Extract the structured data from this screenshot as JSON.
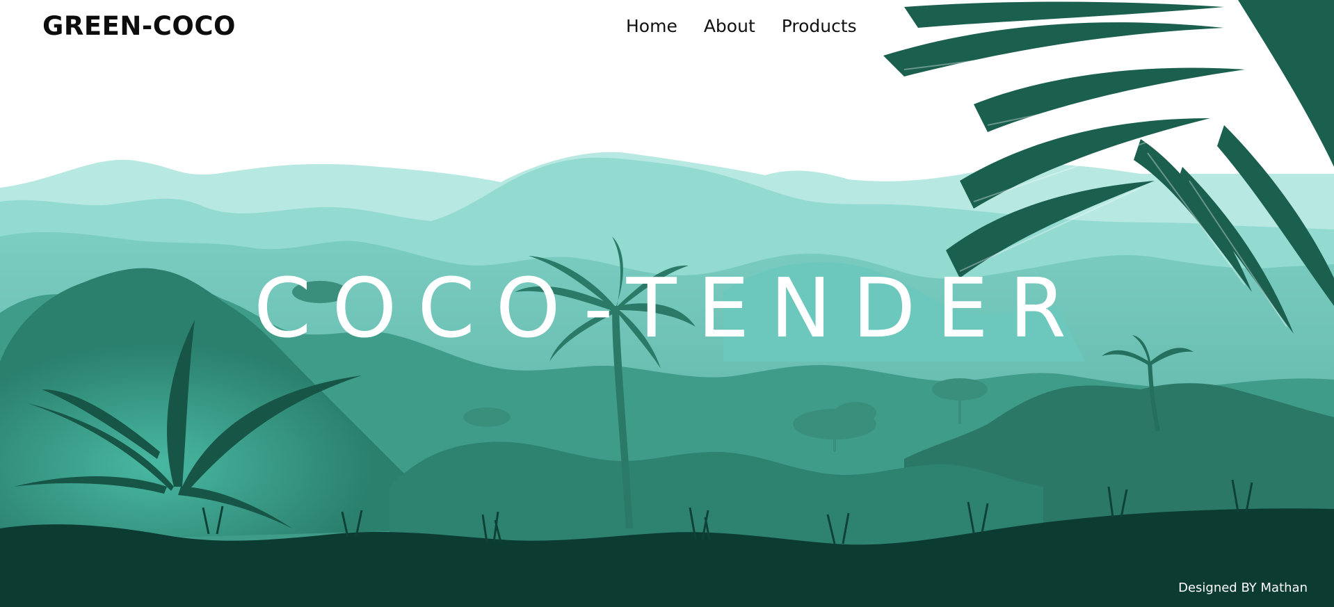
{
  "header": {
    "logo": "GREEN-COCO",
    "nav": [
      {
        "label": "Home"
      },
      {
        "label": "About"
      },
      {
        "label": "Products"
      }
    ]
  },
  "hero": {
    "title": "COCO-TENDER"
  },
  "footer": {
    "credit": "Designed BY Mathan"
  },
  "palette": {
    "sky": "#ffffff",
    "far_hills": "#b3e6df",
    "mid_hills": "#8fd8cf",
    "teal": "#5cb9aa",
    "deep_teal": "#2f8c79",
    "forest": "#1f6b5b",
    "ground": "#0b3a30",
    "leaf": "#185a4c"
  }
}
